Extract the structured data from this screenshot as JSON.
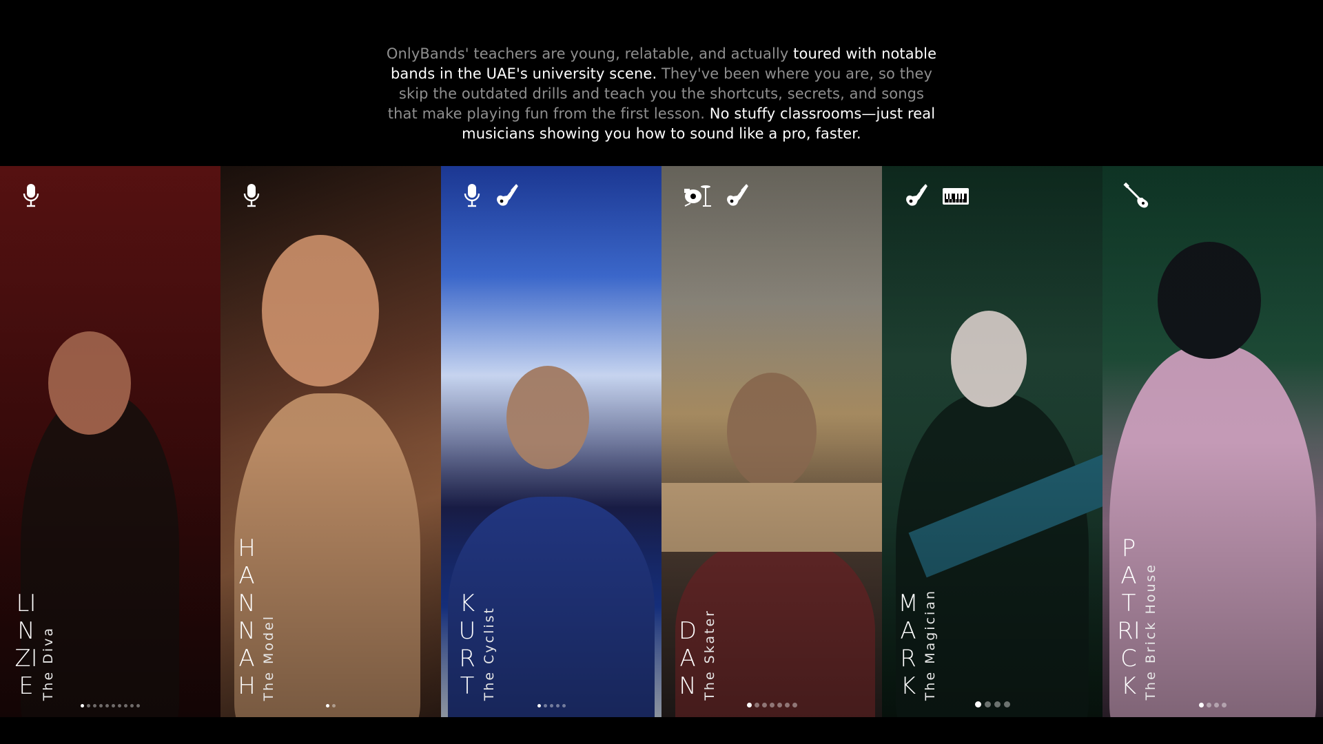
{
  "intro": {
    "seg1": "OnlyBands' teachers are young, relatable, and actually ",
    "seg2": "toured with notable bands in the UAE's university scene.",
    "seg3": " They've been where you are, so they skip the outdated drills and teach you the shortcuts, secrets, and songs that make playing fun from the first lesson. ",
    "seg4": "No stuffy classrooms—just real musicians showing you how to sound like a pro, faster."
  },
  "teachers": [
    {
      "name": "LINZIE",
      "title": "The Diva",
      "icons": [
        "microphone-icon"
      ],
      "dots": {
        "count": 10,
        "active": 0,
        "size": "small"
      }
    },
    {
      "name": "HANNAH",
      "title": "The Model",
      "icons": [
        "microphone-icon"
      ],
      "dots": {
        "count": 2,
        "active": 0,
        "size": "small"
      }
    },
    {
      "name": "KURT",
      "title": "The Cyclist",
      "icons": [
        "microphone-icon",
        "electric-guitar-icon"
      ],
      "dots": {
        "count": 5,
        "active": 0,
        "size": "small"
      }
    },
    {
      "name": "DAN",
      "title": "The Skater",
      "icons": [
        "drum-kit-icon",
        "electric-guitar-icon"
      ],
      "dots": {
        "count": 7,
        "active": 0,
        "size": "medium"
      }
    },
    {
      "name": "MARK",
      "title": "The Magician",
      "icons": [
        "electric-guitar-icon",
        "keyboard-icon"
      ],
      "dots": {
        "count": 4,
        "active": 0,
        "size": "big"
      }
    },
    {
      "name": "PATRICK",
      "title": "The Brick House",
      "icons": [
        "bass-guitar-icon"
      ],
      "dots": {
        "count": 4,
        "active": 0,
        "size": "medium"
      }
    }
  ]
}
